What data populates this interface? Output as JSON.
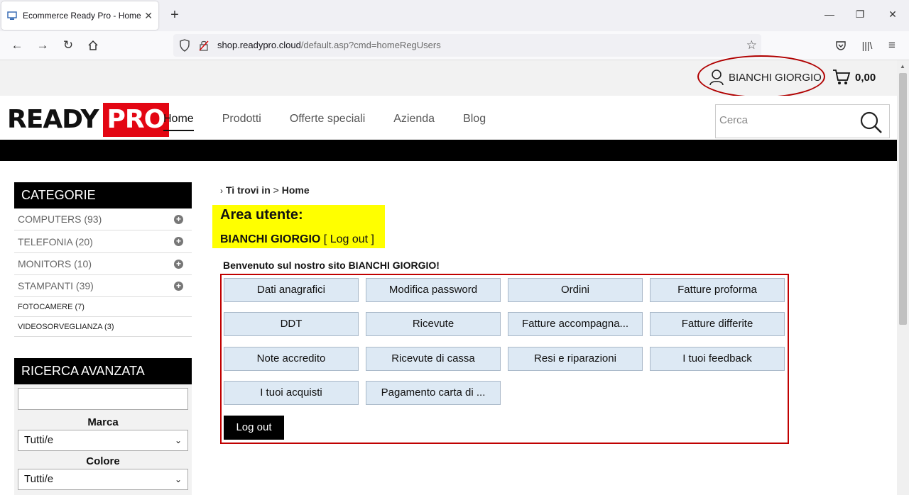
{
  "browser": {
    "tab_title": "Ecommerce Ready Pro - Home",
    "url_domain": "shop.readypro.cloud",
    "url_path": "/default.asp?cmd=homeRegUsers"
  },
  "topbar": {
    "user_name": "BIANCHI GIORGIO",
    "cart_amount": "0,00"
  },
  "header": {
    "logo_ready": "READY",
    "logo_pro": "PRO",
    "nav": [
      "Home",
      "Prodotti",
      "Offerte speciali",
      "Azienda",
      "Blog"
    ],
    "search_placeholder": "Cerca"
  },
  "sidebar": {
    "categories_title": "CATEGORIE",
    "categories": [
      {
        "label": "COMPUTERS (93)"
      },
      {
        "label": "TELEFONIA (20)"
      },
      {
        "label": "MONITORS (10)"
      },
      {
        "label": "STAMPANTI (39)"
      },
      {
        "label": "FOTOCAMERE (7)"
      },
      {
        "label": "VIDEOSORVEGLIANZA (3)"
      }
    ],
    "advanced_title": "RICERCA AVANZATA",
    "brand_label": "Marca",
    "brand_value": "Tutti/e",
    "color_label": "Colore",
    "color_value": "Tutti/e"
  },
  "content": {
    "crumb_prefix": "Ti trovi in",
    "crumb_sep": ">",
    "crumb_page": "Home",
    "area_title": "Area utente:",
    "area_user": "BIANCHI GIORGIO",
    "area_logout_link": "[ Log out ]",
    "welcome": "Benvenuto sul nostro sito BIANCHI GIORGIO!",
    "buttons": [
      "Dati anagrafici",
      "Modifica password",
      "Ordini",
      "Fatture proforma",
      "DDT",
      "Ricevute",
      "Fatture accompagna...",
      "Fatture differite",
      "Note accredito",
      "Ricevute di cassa",
      "Resi e riparazioni",
      "I tuoi feedback",
      "I tuoi acquisti",
      "Pagamento carta di ..."
    ],
    "logout_button": "Log out"
  },
  "colors": {
    "accent_red": "#e30613",
    "highlight_yellow": "#ffff00",
    "button_bg": "#dde9f4"
  }
}
